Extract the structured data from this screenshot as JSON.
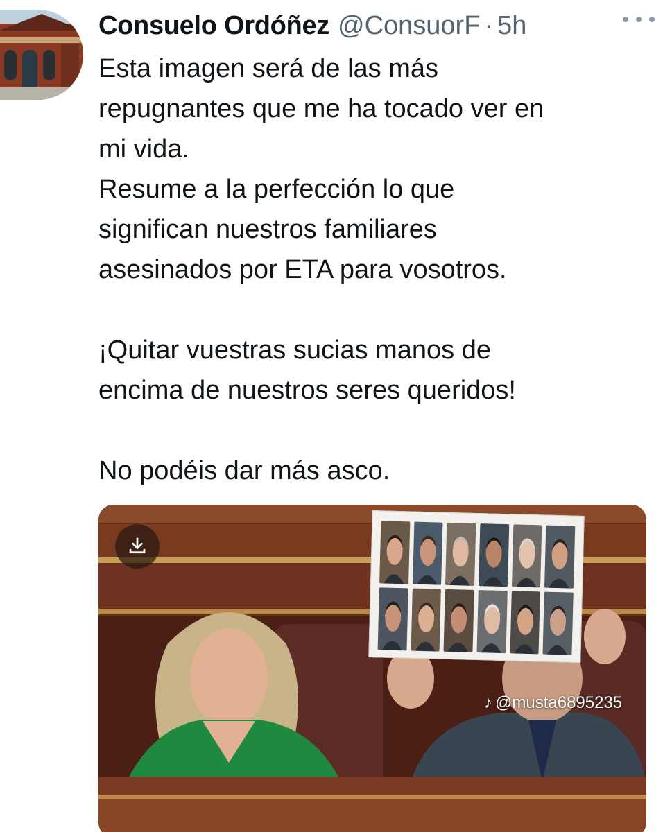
{
  "tweet": {
    "author": {
      "display_name": "Consuelo Ordóñez",
      "handle": "@ConsuorF",
      "separator": "·",
      "time": "5h"
    },
    "text_lines": [
      "Esta imagen será de las más",
      "repugnantes que me ha tocado ver en",
      "mi vida.",
      "Resume a la perfección lo que",
      "significan nuestros familiares",
      "asesinados por ETA para vosotros.",
      "",
      "¡Quitar vuestras sucias manos de",
      "encima de nuestros seres queridos!",
      "",
      "No podéis dar más asco."
    ],
    "media": {
      "watermark_text": "@musta6895235",
      "icons": [
        "download-icon",
        "tiktok-icon"
      ]
    }
  },
  "colors": {
    "text_primary": "#0f1419",
    "text_secondary": "#536471",
    "background": "#ffffff"
  }
}
